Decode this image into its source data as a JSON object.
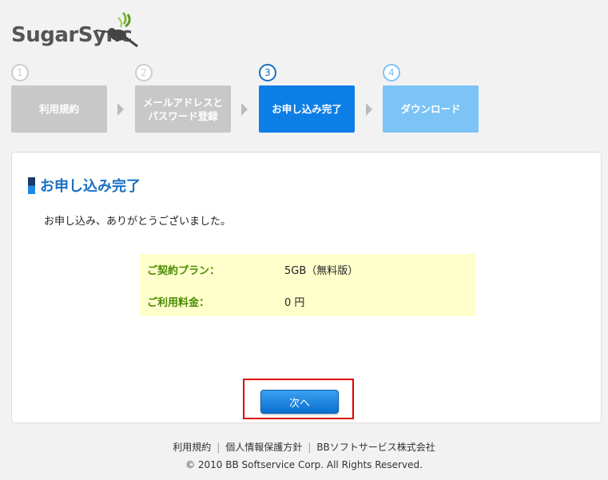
{
  "brand": {
    "name": "SugarSync",
    "accent": "#1a6fc4"
  },
  "steps": [
    {
      "num": "1",
      "label": "利用規約",
      "state": "done"
    },
    {
      "num": "2",
      "label_line1": "メールアドレスと",
      "label_line2": "パスワード登録",
      "state": "done"
    },
    {
      "num": "3",
      "label": "お申し込み完了",
      "state": "current"
    },
    {
      "num": "4",
      "label": "ダウンロード",
      "state": "upcoming"
    }
  ],
  "panel": {
    "title": "お申し込み完了",
    "message": "お申し込み、ありがとうございました。",
    "plan_label": "ご契約プラン：",
    "plan_value": "5GB（無料版）",
    "fee_label": "ご利用料金：",
    "fee_value": "0 円",
    "next_button": "次へ"
  },
  "footer": {
    "links": [
      "利用規約",
      "個人情報保護方針",
      "BBソフトサービス株式会社"
    ],
    "copyright": "© 2010 BB Softservice Corp. All Rights Reserved."
  }
}
